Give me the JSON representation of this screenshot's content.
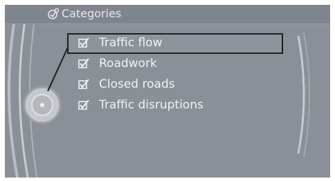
{
  "header": {
    "title": "Categories",
    "icon": "traffic-settings-icon"
  },
  "categories": {
    "items": [
      {
        "label": "Traffic flow",
        "checked": true,
        "selected": true
      },
      {
        "label": "Roadwork",
        "checked": true,
        "selected": false
      },
      {
        "label": "Closed roads",
        "checked": true,
        "selected": false
      },
      {
        "label": "Traffic disruptions",
        "checked": true,
        "selected": false
      }
    ]
  },
  "colors": {
    "screen_background": "#8a9097",
    "text": "#f2f3f4",
    "selection_border": "#1d1f21"
  }
}
